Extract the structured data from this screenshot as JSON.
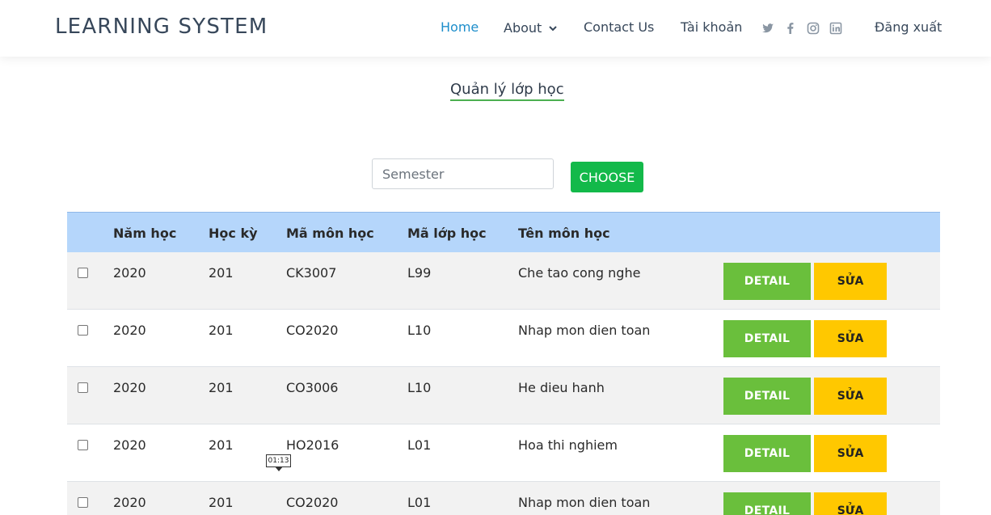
{
  "header": {
    "brand": "LEARNING SYSTEM",
    "nav": {
      "home": "Home",
      "about": "About",
      "contact": "Contact Us",
      "account": "Tài khoản",
      "logout": "Đăng xuất"
    },
    "social_icons": [
      "twitter-icon",
      "facebook-icon",
      "instagram-icon",
      "linkedin-icon"
    ],
    "active_color": "#1e8ecb"
  },
  "main": {
    "title": "Quản lý lớp học",
    "filter": {
      "placeholder": "Semester",
      "button": "CHOOSE"
    },
    "table": {
      "headers": [
        "Năm học",
        "Học kỳ",
        "Mã môn học",
        "Mã lớp học",
        "Tên môn học"
      ],
      "detail_label": "DETAIL",
      "edit_label": "SỬA",
      "rows": [
        {
          "year": "2020",
          "semester": "201",
          "course_code": "CK3007",
          "class_code": "L99",
          "course_name": "Che tao cong nghe"
        },
        {
          "year": "2020",
          "semester": "201",
          "course_code": "CO2020",
          "class_code": "L10",
          "course_name": "Nhap mon dien toan"
        },
        {
          "year": "2020",
          "semester": "201",
          "course_code": "CO3006",
          "class_code": "L10",
          "course_name": "He dieu hanh"
        },
        {
          "year": "2020",
          "semester": "201",
          "course_code": "HO2016",
          "class_code": "L01",
          "course_name": "Hoa thi nghiem"
        },
        {
          "year": "2020",
          "semester": "201",
          "course_code": "CO2020",
          "class_code": "L01",
          "course_name": "Nhap mon dien toan"
        }
      ]
    }
  },
  "overlay": {
    "tooltip_time": "01:13"
  }
}
